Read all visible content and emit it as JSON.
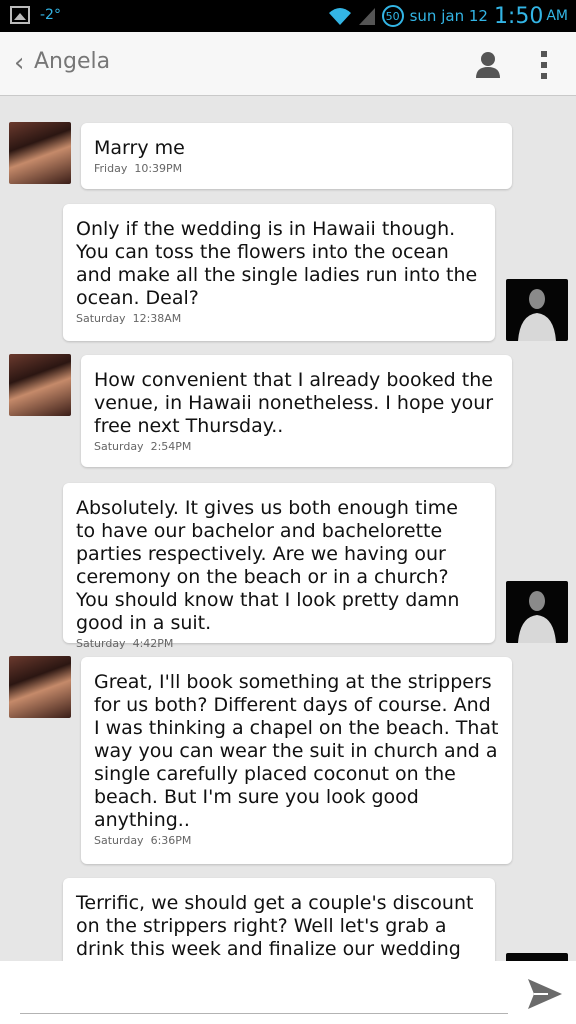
{
  "status_bar": {
    "temperature": "-2°",
    "notification_count": "50",
    "date": "sun jan 12",
    "time": "1:50",
    "ampm": "AM"
  },
  "header": {
    "back_glyph": "‹",
    "title": "Angela"
  },
  "messages": [
    {
      "sender": "Angela",
      "text": "Marry me",
      "day": "Friday",
      "time": "10:39PM"
    },
    {
      "sender": "me",
      "text": "Only if the wedding is in Hawaii though. You can toss the flowers into the ocean and make all the single ladies run into the ocean. Deal?",
      "day": "Saturday",
      "time": "12:38AM"
    },
    {
      "sender": "Angela",
      "text": "How convenient that I already booked the venue, in Hawaii nonetheless. I hope your free next Thursday..",
      "day": "Saturday",
      "time": "2:54PM"
    },
    {
      "sender": "me",
      "text": "Absolutely. It gives us both enough time to have our bachelor and bachelorette parties respectively. Are we having our ceremony on the beach or in a church? You should know that I look pretty damn good in a suit.",
      "day": "Saturday",
      "time": "4:42PM"
    },
    {
      "sender": "Angela",
      "text": "Great, I'll book something at the strippers for us both? Different days of course. And I was thinking a chapel on the beach. That way you can wear the suit in church and a single carefully placed coconut on the beach. But I'm sure you look good anything..",
      "day": "Saturday",
      "time": "6:36PM"
    },
    {
      "sender": "me",
      "text": "Terrific, we should get a couple's discount on the strippers right? Well let's grab a drink this week and finalize our wedding plans.",
      "day": "",
      "time": ""
    }
  ],
  "compose": {
    "placeholder": "",
    "value": ""
  },
  "icons": {
    "back": "chevron-left-icon",
    "contact": "person-icon",
    "menu": "overflow-menu-icon",
    "send": "send-icon"
  },
  "colors": {
    "accent": "#33b5e5",
    "chat_background": "#e6e6e6",
    "bubble": "#ffffff"
  }
}
